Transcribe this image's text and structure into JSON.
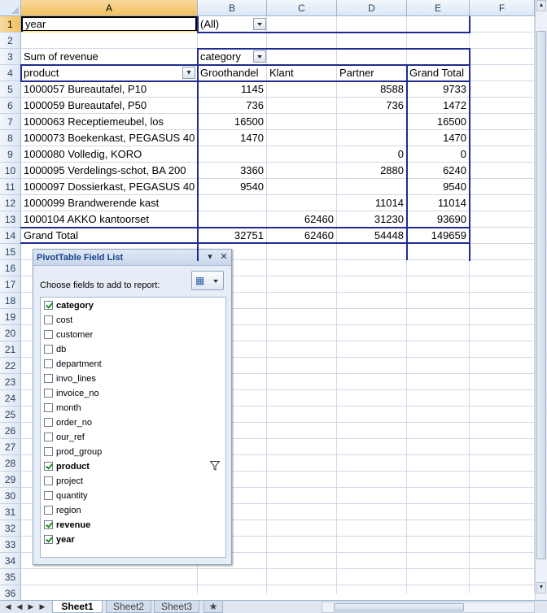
{
  "columns": [
    "A",
    "B",
    "C",
    "D",
    "E",
    "F"
  ],
  "rows": [
    "1",
    "2",
    "3",
    "4",
    "5",
    "6",
    "7",
    "8",
    "9",
    "10",
    "11",
    "12",
    "13",
    "14",
    "15",
    "16",
    "17",
    "18",
    "19",
    "20",
    "21",
    "22",
    "23",
    "24",
    "25",
    "26",
    "27",
    "28",
    "29",
    "30",
    "31",
    "32",
    "33",
    "34",
    "35",
    "36"
  ],
  "pivot": {
    "filter_label": "year",
    "filter_value": "(All)",
    "values_label": "Sum of revenue",
    "col_field": "category",
    "row_field": "product",
    "col_headers": [
      "Groothandel",
      "Klant",
      "Partner",
      "Grand Total"
    ],
    "data_rows": [
      {
        "product": "1000057 Bureautafel, P10",
        "g": "1145",
        "k": "",
        "p": "8588",
        "t": "9733"
      },
      {
        "product": "1000059 Bureautafel, P50",
        "g": "736",
        "k": "",
        "p": "736",
        "t": "1472"
      },
      {
        "product": "1000063 Receptiemeubel, los",
        "g": "16500",
        "k": "",
        "p": "",
        "t": "16500"
      },
      {
        "product": "1000073 Boekenkast, PEGASUS 40",
        "g": "1470",
        "k": "",
        "p": "",
        "t": "1470"
      },
      {
        "product": "1000080 Volledig, KORO",
        "g": "",
        "k": "",
        "p": "0",
        "t": "0"
      },
      {
        "product": "1000095 Verdelings-schot, BA 200",
        "g": "3360",
        "k": "",
        "p": "2880",
        "t": "6240"
      },
      {
        "product": "1000097 Dossierkast, PEGASUS 40",
        "g": "9540",
        "k": "",
        "p": "",
        "t": "9540"
      },
      {
        "product": "1000099 Brandwerende kast",
        "g": "",
        "k": "",
        "p": "11014",
        "t": "11014"
      },
      {
        "product": "1000104 AKKO kantoorset",
        "g": "",
        "k": "62460",
        "p": "31230",
        "t": "93690"
      }
    ],
    "grand_total": {
      "label": "Grand Total",
      "g": "32751",
      "k": "62460",
      "p": "54448",
      "t": "149659"
    }
  },
  "field_list": {
    "title": "PivotTable Field List",
    "choose_label": "Choose fields to add to report:",
    "fields": [
      {
        "name": "category",
        "checked": true,
        "filtered": false
      },
      {
        "name": "cost",
        "checked": false,
        "filtered": false
      },
      {
        "name": "customer",
        "checked": false,
        "filtered": false
      },
      {
        "name": "db",
        "checked": false,
        "filtered": false
      },
      {
        "name": "department",
        "checked": false,
        "filtered": false
      },
      {
        "name": "invo_lines",
        "checked": false,
        "filtered": false
      },
      {
        "name": "invoice_no",
        "checked": false,
        "filtered": false
      },
      {
        "name": "month",
        "checked": false,
        "filtered": false
      },
      {
        "name": "order_no",
        "checked": false,
        "filtered": false
      },
      {
        "name": "our_ref",
        "checked": false,
        "filtered": false
      },
      {
        "name": "prod_group",
        "checked": false,
        "filtered": false
      },
      {
        "name": "product",
        "checked": true,
        "filtered": true
      },
      {
        "name": "project",
        "checked": false,
        "filtered": false
      },
      {
        "name": "quantity",
        "checked": false,
        "filtered": false
      },
      {
        "name": "region",
        "checked": false,
        "filtered": false
      },
      {
        "name": "revenue",
        "checked": true,
        "filtered": false
      },
      {
        "name": "year",
        "checked": true,
        "filtered": false
      }
    ]
  },
  "sheets": [
    "Sheet1",
    "Sheet2",
    "Sheet3"
  ],
  "active_sheet": "Sheet1",
  "colors": {
    "pivot_border": "#1f2b8f",
    "header_bg": "#dce6f4",
    "selected_header": "#f1c15f",
    "check": "#1c8d1c"
  }
}
